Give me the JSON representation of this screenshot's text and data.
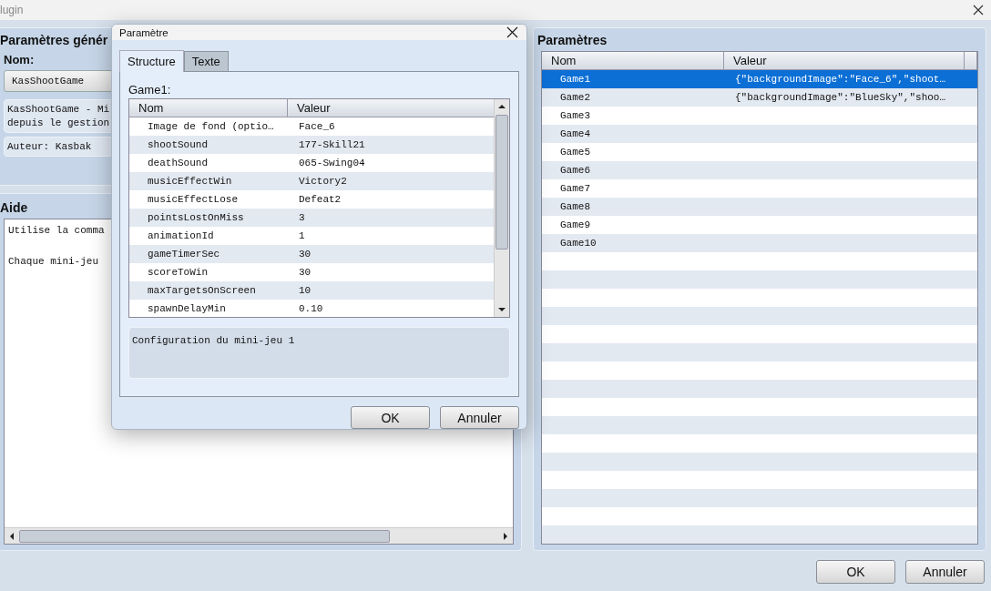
{
  "window": {
    "title": "lugin"
  },
  "general": {
    "heading": "Paramètres génér",
    "name_label": "Nom:",
    "name": "KasShootGame",
    "description_lines": [
      "KasShootGame - Mi",
      "depuis le gestion"
    ],
    "author": "Auteur: Kasbak"
  },
  "help": {
    "heading": "Aide",
    "paragraphs": [
      "Utilise la comma",
      "Chaque mini-jeu"
    ]
  },
  "parameters": {
    "heading": "Paramètres",
    "columns": [
      "Nom",
      "Valeur"
    ],
    "rows": [
      {
        "name": "Game1",
        "value": "{\"backgroundImage\":\"Face_6\",\"shoot…",
        "selected": true
      },
      {
        "name": "Game2",
        "value": "{\"backgroundImage\":\"BlueSky\",\"shoo…",
        "selected": false
      },
      {
        "name": "Game3",
        "selected": false
      },
      {
        "name": "Game4",
        "selected": false
      },
      {
        "name": "Game5",
        "selected": false
      },
      {
        "name": "Game6",
        "selected": false
      },
      {
        "name": "Game7",
        "selected": false
      },
      {
        "name": "Game8",
        "selected": false
      },
      {
        "name": "Game9",
        "selected": false
      },
      {
        "name": "Game10",
        "selected": false
      }
    ]
  },
  "buttons": [
    "OK",
    "Annuler"
  ],
  "dialog": {
    "title": "Paramètre",
    "tabs": [
      {
        "label": "Structure",
        "selected": true
      },
      {
        "label": "Texte",
        "selected": false
      }
    ],
    "group_label": "Game1:",
    "columns": [
      "Nom",
      "Valeur"
    ],
    "rows": [
      {
        "name": "Image de fond (optio…",
        "value": "Face_6"
      },
      {
        "name": "shootSound",
        "value": "177-Skill21"
      },
      {
        "name": "deathSound",
        "value": "065-Swing04"
      },
      {
        "name": "musicEffectWin",
        "value": "Victory2"
      },
      {
        "name": "musicEffectLose",
        "value": "Defeat2"
      },
      {
        "name": "pointsLostOnMiss",
        "value": "3"
      },
      {
        "name": "animationId",
        "value": "1"
      },
      {
        "name": "gameTimerSec",
        "value": "30"
      },
      {
        "name": "scoreToWin",
        "value": "30"
      },
      {
        "name": "maxTargetsOnScreen",
        "value": "10"
      },
      {
        "name": "spawnDelayMin",
        "value": "0.10"
      }
    ],
    "description": "Configuration du mini-jeu 1",
    "buttons": [
      "OK",
      "Annuler"
    ]
  }
}
